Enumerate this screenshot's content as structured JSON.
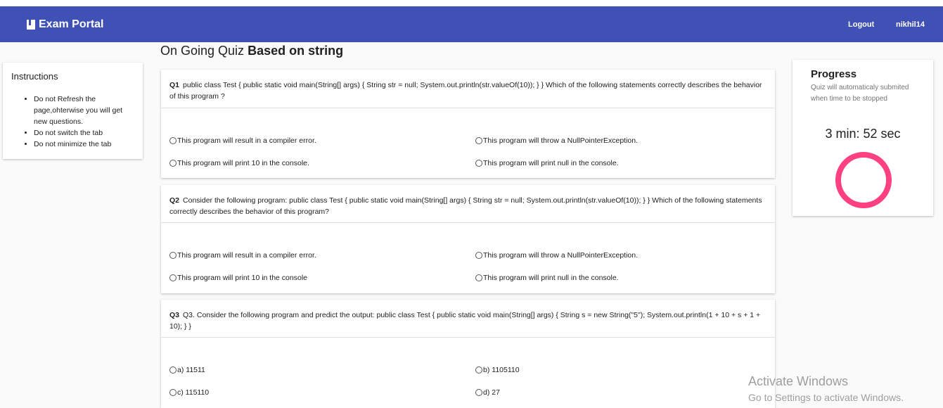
{
  "navbar": {
    "brand": "Exam Portal",
    "logout": "Logout",
    "username": "nikhil14"
  },
  "instructions": {
    "title": "Instructions",
    "items": [
      "Do not Refresh the page,ohterwise you will get new questions.",
      "Do not switch the tab",
      "Do not minimize the tab"
    ]
  },
  "quiz": {
    "title_prefix": "On Going Quiz",
    "title_name": "Based on string",
    "questions": [
      {
        "number": "Q1",
        "text": "public class Test { public static void main(String[] args) { String str = null; System.out.println(str.valueOf(10)); } } Which of the following statements correctly describes the behavior of this program ?",
        "options": [
          "This program will result in a compiler error.",
          "This program will throw a NullPointerException.",
          "This program will print 10 in the console.",
          "This program will print null in the console."
        ]
      },
      {
        "number": "Q2",
        "text": "Consider the following program: public class Test { public static void main(String[] args) { String str = null; System.out.println(str.valueOf(10)); } } Which of the following statements correctly describes the behavior of this program?",
        "options": [
          " This program will result in a compiler error.",
          " This program will throw a NullPointerException.",
          "This program will print 10 in the console",
          "This program will print null in the console."
        ]
      },
      {
        "number": "Q3",
        "text": "Q3. Consider the following program and predict the output: public class Test { public static void main(String[] args) { String s = new String(\"5\"); System.out.println(1 + 10 + s + 1 + 10); } }",
        "options": [
          "a) 11511",
          "b) 1105110",
          "c) 115110",
          "d) 27"
        ]
      }
    ]
  },
  "progress": {
    "title": "Progress",
    "subtitle": "Quiz will automaticaly submited when time to be stopped",
    "timer": "3 min: 52 sec",
    "spinner_color": "#ff4081",
    "fraction_remaining": 1.0
  },
  "watermark": {
    "line1": "Activate Windows",
    "line2": "Go to Settings to activate Windows."
  },
  "colors": {
    "navbar": "#3f51b5",
    "accent": "#ff4081"
  }
}
